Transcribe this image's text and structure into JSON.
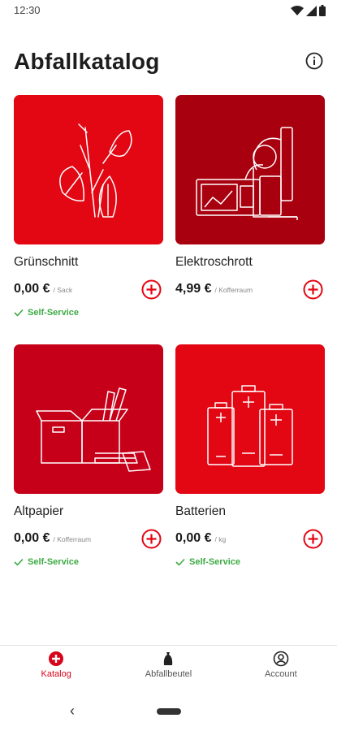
{
  "status_bar": {
    "time": "12:30",
    "icons": [
      "wifi-icon",
      "cell-signal-icon",
      "battery-icon"
    ]
  },
  "header": {
    "title": "Abfallkatalog",
    "info_icon": "info-icon"
  },
  "colors": {
    "brand_red": "#e30613",
    "dark_red": "#a8000f",
    "mid_red": "#c7001a",
    "green": "#3cab43"
  },
  "items": [
    {
      "name": "Grünschnitt",
      "price": "0,00 €",
      "unit": "/ Sack",
      "self_service": "Self-Service",
      "icon": "plant-icon"
    },
    {
      "name": "Elektroschrott",
      "price": "4,99 €",
      "unit": "/ Kofferraum",
      "self_service": "",
      "icon": "appliances-icon"
    },
    {
      "name": "Altpapier",
      "price": "0,00 €",
      "unit": "/ Kofferraum",
      "self_service": "Self-Service",
      "icon": "paper-box-icon"
    },
    {
      "name": "Batterien",
      "price": "0,00 €",
      "unit": "/ kg",
      "self_service": "Self-Service",
      "icon": "batteries-icon"
    }
  ],
  "bottom_nav": [
    {
      "label": "Katalog",
      "icon": "catalog-plus-icon",
      "active": true
    },
    {
      "label": "Abfallbeutel",
      "icon": "waste-bag-icon",
      "active": false
    },
    {
      "label": "Account",
      "icon": "account-icon",
      "active": false
    }
  ]
}
